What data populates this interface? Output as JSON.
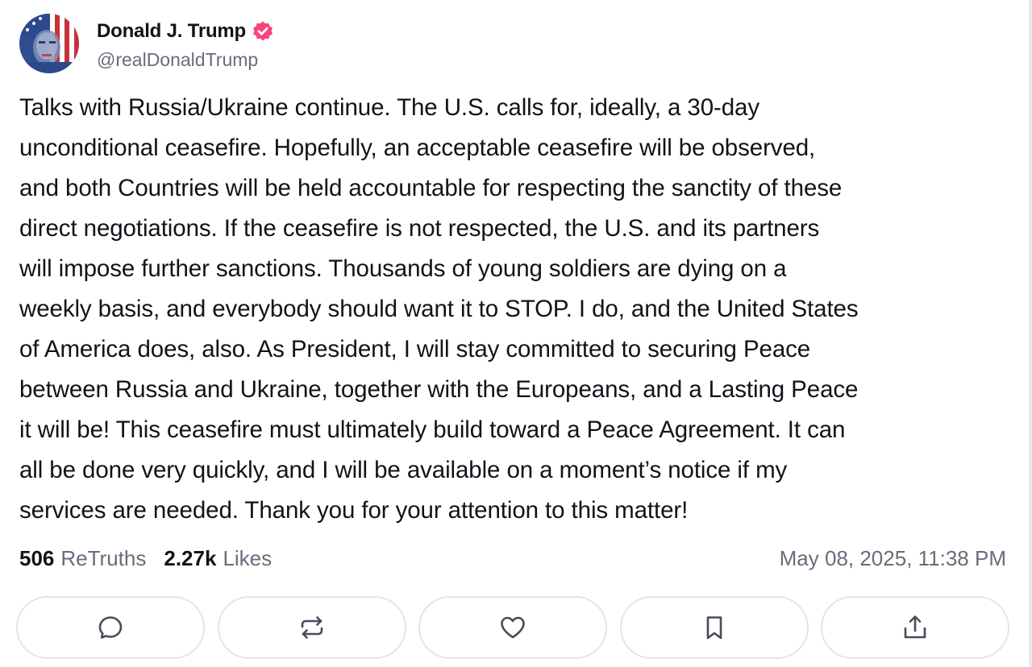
{
  "author": {
    "display_name": "Donald J. Trump",
    "handle": "@realDonaldTrump",
    "verified": true,
    "avatar_icon": "avatar-flag-portrait"
  },
  "post": {
    "text": "Talks with Russia/Ukraine continue. The U.S. calls for, ideally, a 30-day unconditional ceasefire. Hopefully, an acceptable ceasefire will be observed, and both Countries will be held accountable for respecting the sanctity of these direct negotiations. If the ceasefire is not respected, the U.S. and its partners will impose further sanctions. Thousands of young soldiers are dying on a weekly basis, and everybody should want it to STOP. I do, and the United States of America does, also. As President, I will stay committed to securing Peace between Russia and Ukraine, together with the Europeans, and a Lasting Peace it will be! This ceasefire must ultimately build toward a Peace Agreement. It can all be done very quickly, and I will be available on a moment’s notice if my services are needed. Thank you for your attention to this matter!",
    "lines": [
      "Talks with Russia/Ukraine continue. The U.S. calls for, ideally, a 30-day",
      "unconditional ceasefire. Hopefully, an acceptable ceasefire will be observed,",
      "and both Countries will be held accountable for respecting the sanctity of these",
      "direct negotiations. If the ceasefire is not respected, the U.S. and its partners",
      "will impose further sanctions. Thousands of young soldiers are dying on a",
      "weekly basis, and everybody should want it to STOP. I do, and the United States",
      "of America does, also. As President, I will stay committed to securing Peace",
      "between Russia and Ukraine, together with the Europeans, and a Lasting Peace",
      "it will be! This ceasefire must ultimately build toward a Peace Agreement. It can",
      "all be done very quickly, and I will be available on a moment’s notice if my",
      "services are needed. Thank you for your attention to this matter!"
    ]
  },
  "stats": {
    "retruths_count": "506",
    "retruths_label": "ReTruths",
    "likes_count": "2.27k",
    "likes_label": "Likes",
    "timestamp": "May 08, 2025, 11:38 PM"
  },
  "actions": [
    {
      "icon": "reply-icon"
    },
    {
      "icon": "retruth-icon"
    },
    {
      "icon": "like-icon"
    },
    {
      "icon": "bookmark-icon"
    },
    {
      "icon": "share-icon"
    }
  ],
  "colors": {
    "text": "#0f1419",
    "muted": "#6b6b7b",
    "verified_badge": "#f5457a",
    "button_border": "#e4e4ea"
  }
}
